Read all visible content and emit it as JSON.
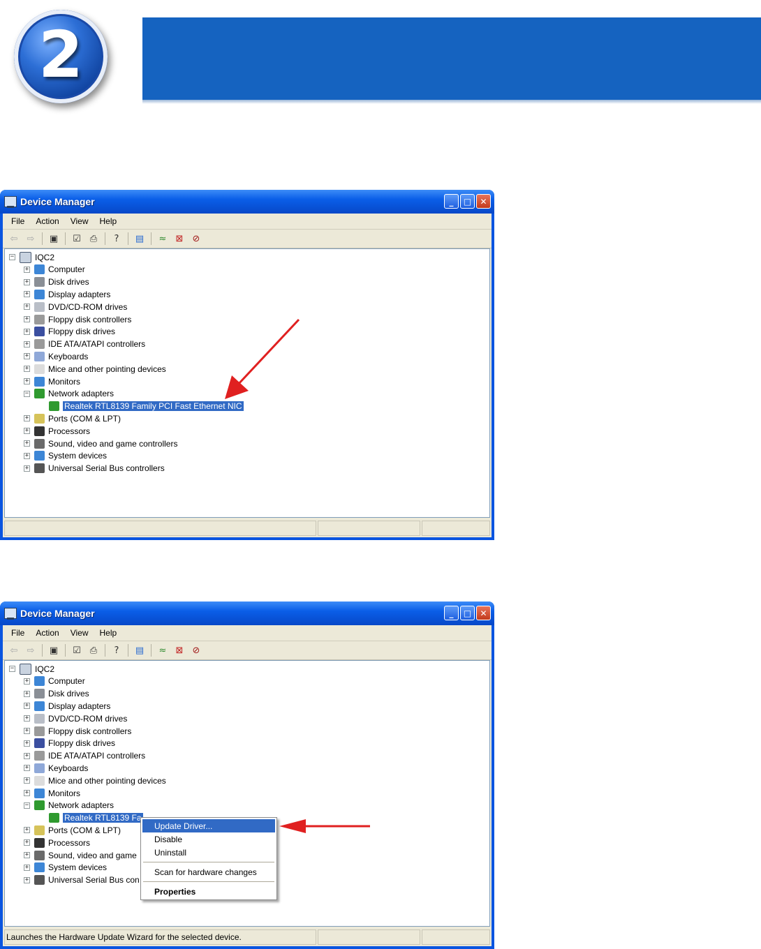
{
  "step": {
    "number": "2"
  },
  "window1": {
    "title": "Device Manager",
    "menu": [
      "File",
      "Action",
      "View",
      "Help"
    ],
    "root": "IQC2",
    "categories": [
      {
        "label": "Computer",
        "color": "#3d86d6"
      },
      {
        "label": "Disk drives",
        "color": "#8a8f96"
      },
      {
        "label": "Display adapters",
        "color": "#3d86d6"
      },
      {
        "label": "DVD/CD-ROM drives",
        "color": "#b9bec7"
      },
      {
        "label": "Floppy disk controllers",
        "color": "#9a9a9a"
      },
      {
        "label": "Floppy disk drives",
        "color": "#3b4fa0"
      },
      {
        "label": "IDE ATA/ATAPI controllers",
        "color": "#9a9a9a"
      },
      {
        "label": "Keyboards",
        "color": "#8fa8d8"
      },
      {
        "label": "Mice and other pointing devices",
        "color": "#dcdcdc"
      },
      {
        "label": "Monitors",
        "color": "#3d86d6"
      },
      {
        "label": "Network adapters",
        "color": "#2f9a2f"
      },
      {
        "label": "Ports (COM & LPT)",
        "color": "#d6c35a"
      },
      {
        "label": "Processors",
        "color": "#333333"
      },
      {
        "label": "Sound, video and game controllers",
        "color": "#6a6a6a"
      },
      {
        "label": "System devices",
        "color": "#3d86d6"
      },
      {
        "label": "Universal Serial Bus controllers",
        "color": "#555555"
      }
    ],
    "selected_device": "Realtek RTL8139 Family PCI Fast Ethernet NIC",
    "status": ""
  },
  "window2": {
    "title": "Device Manager",
    "menu": [
      "File",
      "Action",
      "View",
      "Help"
    ],
    "root": "IQC2",
    "categories": [
      {
        "label": "Computer"
      },
      {
        "label": "Disk drives"
      },
      {
        "label": "Display adapters"
      },
      {
        "label": "DVD/CD-ROM drives"
      },
      {
        "label": "Floppy disk controllers"
      },
      {
        "label": "Floppy disk drives"
      },
      {
        "label": "IDE ATA/ATAPI controllers"
      },
      {
        "label": "Keyboards"
      },
      {
        "label": "Mice and other pointing devices"
      },
      {
        "label": "Monitors"
      },
      {
        "label": "Network adapters"
      },
      {
        "label": "Ports (COM & LPT)"
      },
      {
        "label": "Processors"
      },
      {
        "label": "Sound, video and game"
      },
      {
        "label": "System devices"
      },
      {
        "label": "Universal Serial Bus con"
      }
    ],
    "selected_device": "Realtek RTL8139 Fa",
    "status": "Launches the Hardware Update Wizard for the selected device."
  },
  "context_menu": {
    "update_driver": "Update Driver...",
    "disable": "Disable",
    "uninstall": "Uninstall",
    "scan": "Scan for hardware changes",
    "properties": "Properties"
  },
  "colors": {
    "accent": "#1563c0",
    "title_bar": "#0a5ee8",
    "selection": "#316ac5",
    "arrow": "#e02020"
  },
  "icons": [
    "back-icon",
    "forward-icon",
    "show-hide-tree-icon",
    "properties-icon",
    "print-icon",
    "help-icon",
    "update-driver-icon",
    "scan-hardware-icon",
    "uninstall-icon",
    "disable-icon"
  ]
}
